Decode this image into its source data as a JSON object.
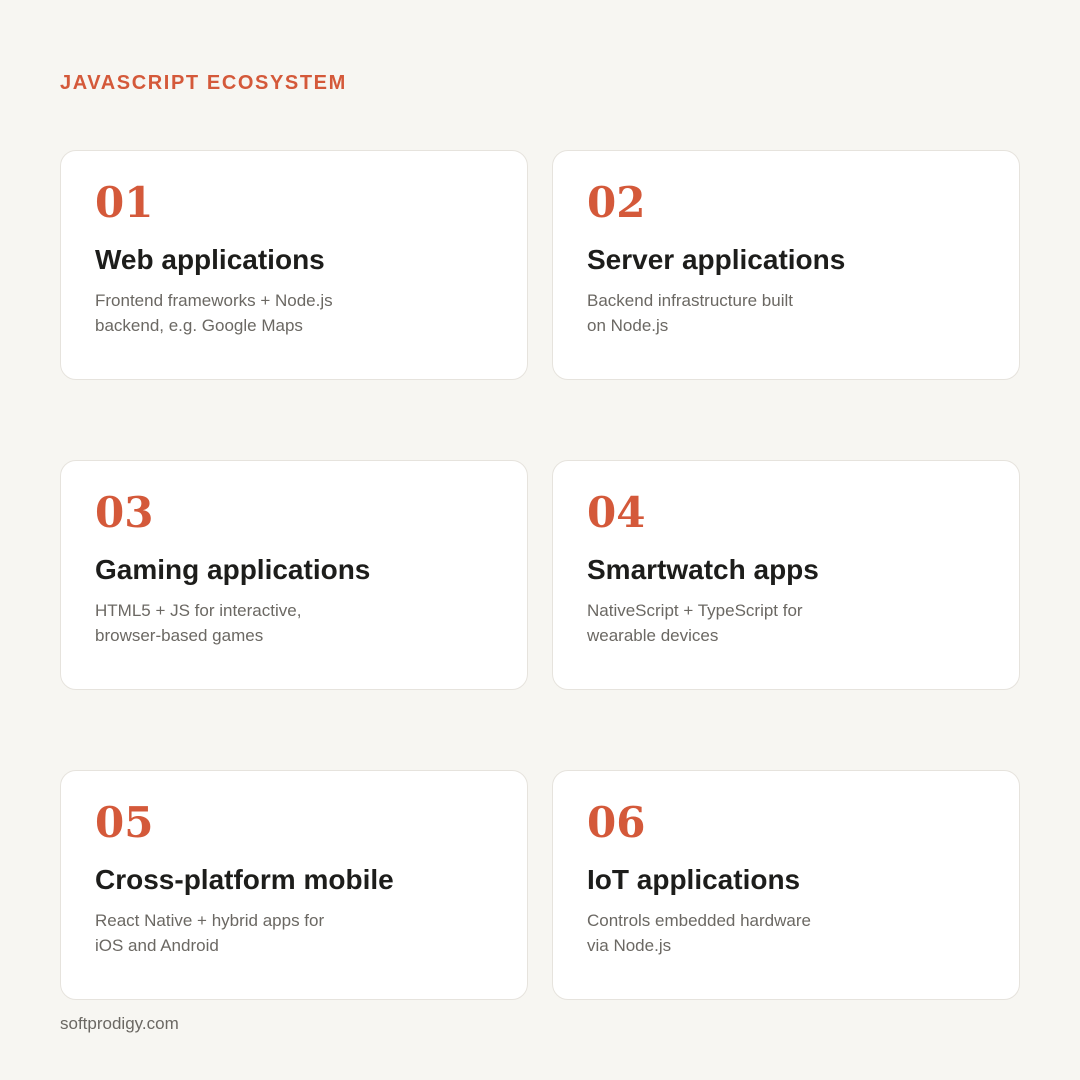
{
  "header": {
    "eyebrow": "JAVASCRIPT ECOSYSTEM"
  },
  "cards": [
    {
      "number": "01",
      "title": "Web applications",
      "desc_lines": [
        "Frontend frameworks + Node.js",
        "backend, e.g. Google Maps"
      ]
    },
    {
      "number": "02",
      "title": "Server applications",
      "desc_lines": [
        "Backend infrastructure built",
        "on Node.js"
      ]
    },
    {
      "number": "03",
      "title": "Gaming applications",
      "desc_lines": [
        "HTML5 + JS for interactive,",
        "browser-based games"
      ]
    },
    {
      "number": "04",
      "title": "Smartwatch apps",
      "desc_lines": [
        "NativeScript + TypeScript for",
        "wearable devices"
      ]
    },
    {
      "number": "05",
      "title": "Cross-platform mobile",
      "desc_lines": [
        "React Native + hybrid apps for",
        "iOS and Android"
      ]
    },
    {
      "number": "06",
      "title": "IoT applications",
      "desc_lines": [
        "Controls embedded hardware",
        "via Node.js"
      ]
    }
  ],
  "footer": {
    "source": "softprodigy.com"
  },
  "colors": {
    "accent": "#d4593a",
    "background": "#f7f6f2",
    "card": "#ffffff",
    "title": "#1d1d1b",
    "body_text": "#6b6863"
  }
}
